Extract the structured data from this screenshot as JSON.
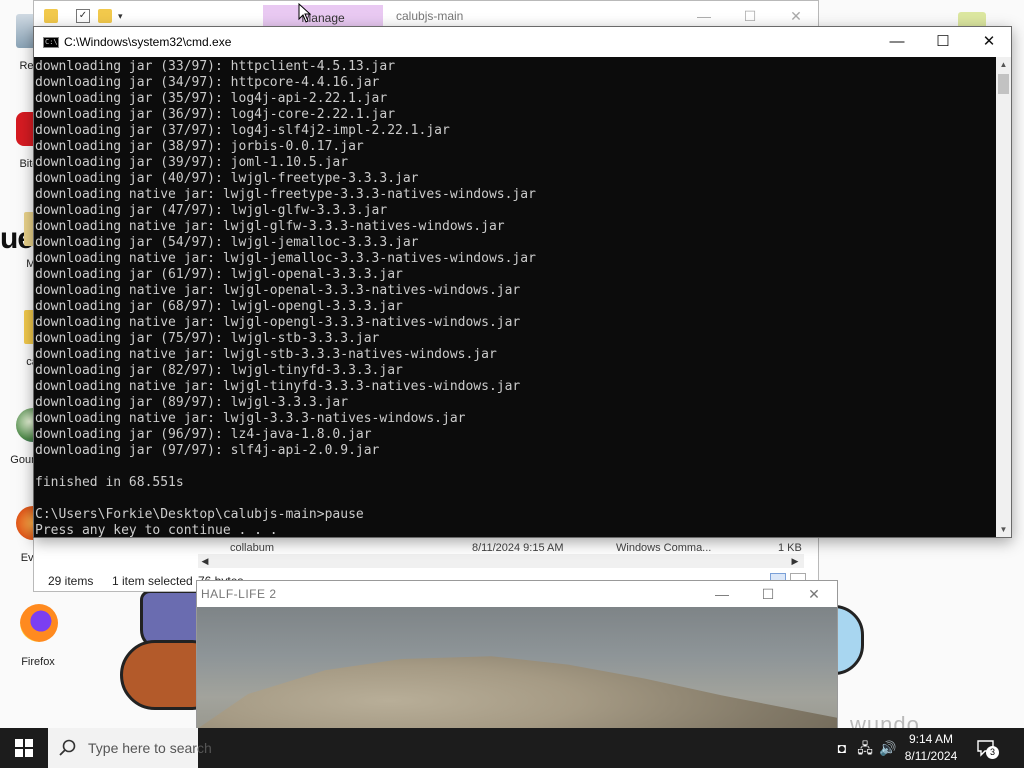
{
  "desktop": {
    "icons": [
      {
        "label": "Recy"
      },
      {
        "label": "Bitde"
      },
      {
        "label": "Mi"
      },
      {
        "label": "ca"
      },
      {
        "label": "Goun\nSo"
      },
      {
        "label": "Ever"
      },
      {
        "label": "Firefox"
      }
    ],
    "partial_text": "ue"
  },
  "explorer": {
    "title": "calubjs-main",
    "manage_tab": "Manage",
    "status_items": "29 items",
    "status_selected": "1 item selected",
    "status_size": "76 bytes",
    "peek_row": {
      "name": "collabum",
      "date": "8/11/2024 9:15 AM",
      "type": "Windows Comma...",
      "size": "1 KB"
    }
  },
  "cmd": {
    "title": "C:\\Windows\\system32\\cmd.exe",
    "lines": [
      "downloading jar (33/97): httpclient-4.5.13.jar",
      "downloading jar (34/97): httpcore-4.4.16.jar",
      "downloading jar (35/97): log4j-api-2.22.1.jar",
      "downloading jar (36/97): log4j-core-2.22.1.jar",
      "downloading jar (37/97): log4j-slf4j2-impl-2.22.1.jar",
      "downloading jar (38/97): jorbis-0.0.17.jar",
      "downloading jar (39/97): joml-1.10.5.jar",
      "downloading jar (40/97): lwjgl-freetype-3.3.3.jar",
      "downloading native jar: lwjgl-freetype-3.3.3-natives-windows.jar",
      "downloading jar (47/97): lwjgl-glfw-3.3.3.jar",
      "downloading native jar: lwjgl-glfw-3.3.3-natives-windows.jar",
      "downloading jar (54/97): lwjgl-jemalloc-3.3.3.jar",
      "downloading native jar: lwjgl-jemalloc-3.3.3-natives-windows.jar",
      "downloading jar (61/97): lwjgl-openal-3.3.3.jar",
      "downloading native jar: lwjgl-openal-3.3.3-natives-windows.jar",
      "downloading jar (68/97): lwjgl-opengl-3.3.3.jar",
      "downloading native jar: lwjgl-opengl-3.3.3-natives-windows.jar",
      "downloading jar (75/97): lwjgl-stb-3.3.3.jar",
      "downloading native jar: lwjgl-stb-3.3.3-natives-windows.jar",
      "downloading jar (82/97): lwjgl-tinyfd-3.3.3.jar",
      "downloading native jar: lwjgl-tinyfd-3.3.3-natives-windows.jar",
      "downloading jar (89/97): lwjgl-3.3.3.jar",
      "downloading native jar: lwjgl-3.3.3-natives-windows.jar",
      "downloading jar (96/97): lz4-java-1.8.0.jar",
      "downloading jar (97/97): slf4j-api-2.0.9.jar",
      "",
      "finished in 68.551s",
      "",
      "C:\\Users\\Forkie\\Desktop\\calubjs-main>pause",
      "Press any key to continue . . ."
    ]
  },
  "hl2": {
    "title": "HALF-LIFE 2"
  },
  "taskbar": {
    "search_placeholder": "Type here to search",
    "time": "9:14 AM",
    "date": "8/11/2024",
    "notification_count": "3"
  },
  "watermark": "wundo"
}
